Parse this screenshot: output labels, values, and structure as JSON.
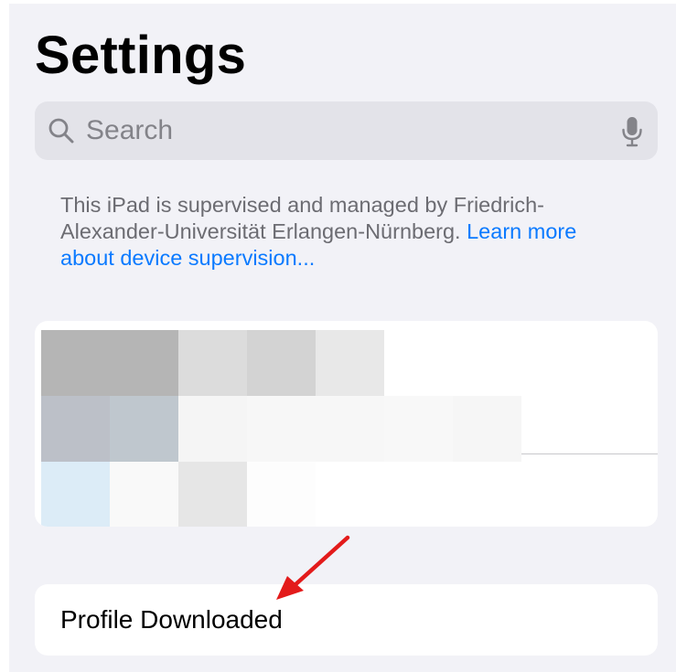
{
  "header": {
    "title": "Settings"
  },
  "search": {
    "placeholder": "Search",
    "icon": "search-icon",
    "mic_icon": "microphone-icon"
  },
  "supervision": {
    "text": "This iPad is supervised and managed by Friedrich-Alexander-Universität Erlangen-Nürnberg. ",
    "link": "Learn more about device supervision..."
  },
  "profile_row": {
    "label": "Profile Downloaded"
  },
  "annotation": {
    "arrow_color": "#e31b1b"
  },
  "colors": {
    "background": "#f2f2f7",
    "card": "#ffffff",
    "link": "#0a7aff",
    "secondary_text": "#6c6c72"
  },
  "account_card": {
    "redacted": true,
    "blur_cells": [
      {
        "col": 0,
        "row": 0,
        "color": "#b5b5b5"
      },
      {
        "col": 1,
        "row": 0,
        "color": "#b5b5b5"
      },
      {
        "col": 2,
        "row": 0,
        "color": "#dcdcdc"
      },
      {
        "col": 3,
        "row": 0,
        "color": "#d3d3d3"
      },
      {
        "col": 4,
        "row": 0,
        "color": "#e8e8e8"
      },
      {
        "col": 0,
        "row": 1,
        "color": "#bcc0c8"
      },
      {
        "col": 1,
        "row": 1,
        "color": "#bfc7ce"
      },
      {
        "col": 2,
        "row": 1,
        "color": "#f5f5f5"
      },
      {
        "col": 3,
        "row": 1,
        "color": "#f7f7f7"
      },
      {
        "col": 4,
        "row": 1,
        "color": "#f7f7f7"
      },
      {
        "col": 5,
        "row": 1,
        "color": "#f8f8f8"
      },
      {
        "col": 6,
        "row": 1,
        "color": "#f6f6f6"
      },
      {
        "col": 0,
        "row": 2,
        "color": "#dcecf7"
      },
      {
        "col": 1,
        "row": 2,
        "color": "#f9f9f9"
      },
      {
        "col": 2,
        "row": 2,
        "color": "#e6e6e6"
      },
      {
        "col": 3,
        "row": 2,
        "color": "#fdfdfd"
      },
      {
        "col": 4,
        "row": 2,
        "color": "#ffffff"
      },
      {
        "col": 5,
        "row": 2,
        "color": "#ffffff"
      },
      {
        "col": 6,
        "row": 2,
        "color": "#ffffff"
      }
    ]
  }
}
